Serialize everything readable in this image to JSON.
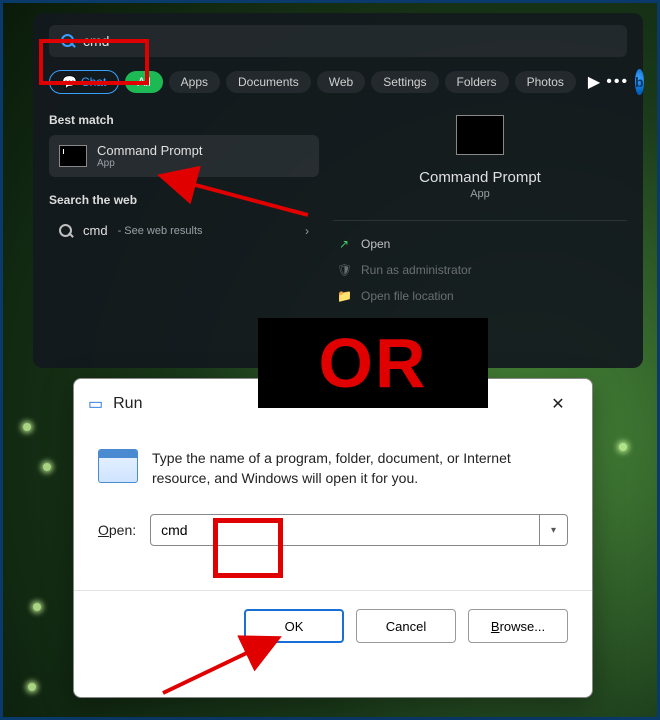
{
  "search": {
    "value": "cmd",
    "tabs": {
      "chat": "Chat",
      "all": "All",
      "apps": "Apps",
      "documents": "Documents",
      "web": "Web",
      "settings": "Settings",
      "folders": "Folders",
      "photos": "Photos"
    },
    "best_match_heading": "Best match",
    "best_match": {
      "title": "Command Prompt",
      "subtitle": "App"
    },
    "search_web_heading": "Search the web",
    "web_result": {
      "query": "cmd",
      "hint": "- See web results"
    },
    "detail": {
      "title": "Command Prompt",
      "subtitle": "App",
      "actions": {
        "open": "Open",
        "admin": "Run as administrator",
        "location": "Open file location"
      }
    }
  },
  "or_label": "OR",
  "run": {
    "title": "Run",
    "hint": "Type the name of a program, folder, document, or Internet resource, and Windows will open it for you.",
    "open_label_pre": "O",
    "open_label_rest": "pen:",
    "input_value": "cmd",
    "buttons": {
      "ok": "OK",
      "cancel": "Cancel",
      "browse_pre": "B",
      "browse_rest": "rowse..."
    }
  }
}
